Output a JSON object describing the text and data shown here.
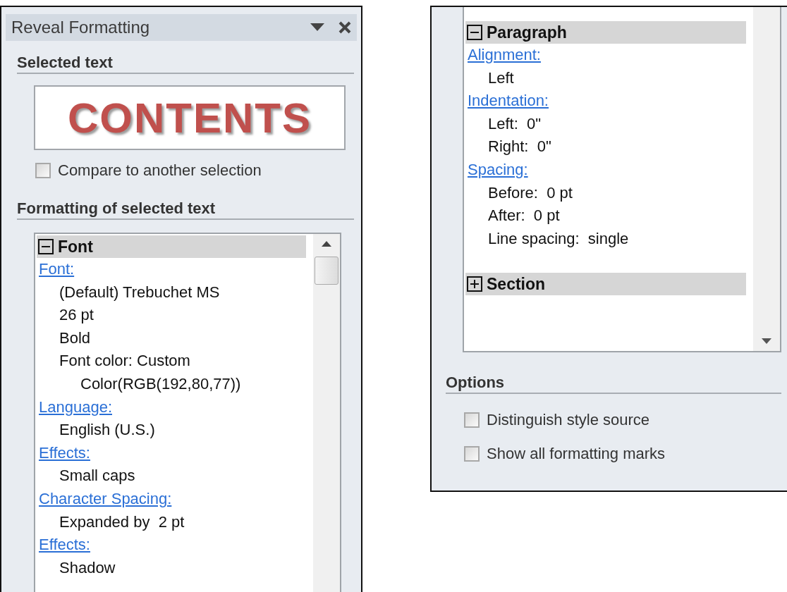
{
  "left_panel": {
    "title": "Reveal Formatting",
    "selected_text": {
      "heading": "Selected text",
      "preview": "CONTENTS"
    },
    "compare": {
      "label": "Compare to another selection",
      "checked": false
    },
    "formatting_heading": "Formatting of selected text",
    "groups": [
      {
        "header": "Font",
        "expanded": true,
        "entries": [
          {
            "kind": "link",
            "text": "Font:"
          },
          {
            "kind": "value",
            "text": "(Default) Trebuchet MS"
          },
          {
            "kind": "value",
            "text": "26 pt"
          },
          {
            "kind": "value",
            "text": "Bold"
          },
          {
            "kind": "value",
            "text": "Font color: Custom",
            "children": [
              {
                "kind": "value",
                "text": "Color(RGB(192,80,77))"
              }
            ]
          },
          {
            "kind": "link",
            "text": "Language:"
          },
          {
            "kind": "value",
            "text": "English (U.S.)"
          },
          {
            "kind": "link",
            "text": "Effects:"
          },
          {
            "kind": "value",
            "text": "Small caps"
          },
          {
            "kind": "link",
            "text": "Character Spacing:"
          },
          {
            "kind": "value",
            "text": "Expanded by  2 pt"
          },
          {
            "kind": "link",
            "text": "Effects:"
          },
          {
            "kind": "value",
            "text": "Shadow"
          }
        ]
      }
    ]
  },
  "right_panel": {
    "groups": [
      {
        "header": "Paragraph",
        "expanded": true,
        "entries": [
          {
            "kind": "link",
            "text": "Alignment:"
          },
          {
            "kind": "value",
            "text": "Left"
          },
          {
            "kind": "link",
            "text": "Indentation:"
          },
          {
            "kind": "value",
            "text": "Left:  0\""
          },
          {
            "kind": "value",
            "text": "Right:  0\""
          },
          {
            "kind": "link",
            "text": "Spacing:"
          },
          {
            "kind": "value",
            "text": "Before:  0 pt"
          },
          {
            "kind": "value",
            "text": "After:  0 pt"
          },
          {
            "kind": "value",
            "text": "Line spacing:  single"
          }
        ]
      },
      {
        "header": "Section",
        "expanded": false
      }
    ],
    "options": {
      "heading": "Options",
      "checkboxes": [
        {
          "label": "Distinguish style source",
          "checked": false
        },
        {
          "label": "Show all formatting marks",
          "checked": false
        }
      ]
    }
  }
}
